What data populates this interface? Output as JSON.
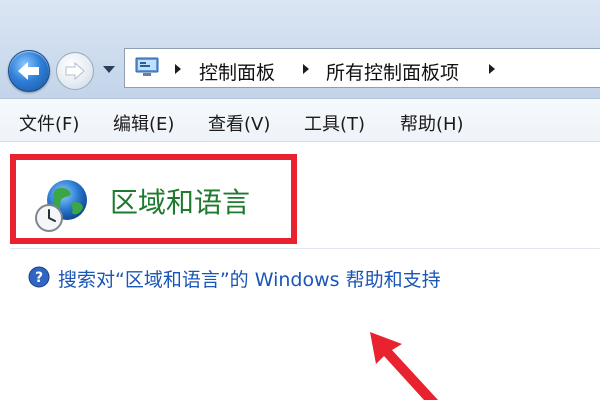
{
  "navigation": {
    "back_icon": "back-arrow-icon",
    "forward_icon": "forward-arrow-icon",
    "recent_pages_icon": "chevron-down-icon"
  },
  "address_bar": {
    "icon": "control-panel-icon",
    "crumbs": [
      "控制面板",
      "所有控制面板项"
    ]
  },
  "menu": {
    "items": [
      "文件(F)",
      "编辑(E)",
      "查看(V)",
      "工具(T)",
      "帮助(H)"
    ]
  },
  "content": {
    "title": "区域和语言",
    "title_icon": "globe-clock-icon",
    "help_icon": "help-icon",
    "help_link": "搜索对“区域和语言”的 Windows 帮助和支持"
  },
  "colors": {
    "title_green": "#1e7a2e",
    "link_blue": "#1a56b6",
    "highlight_red": "#e8232f"
  }
}
